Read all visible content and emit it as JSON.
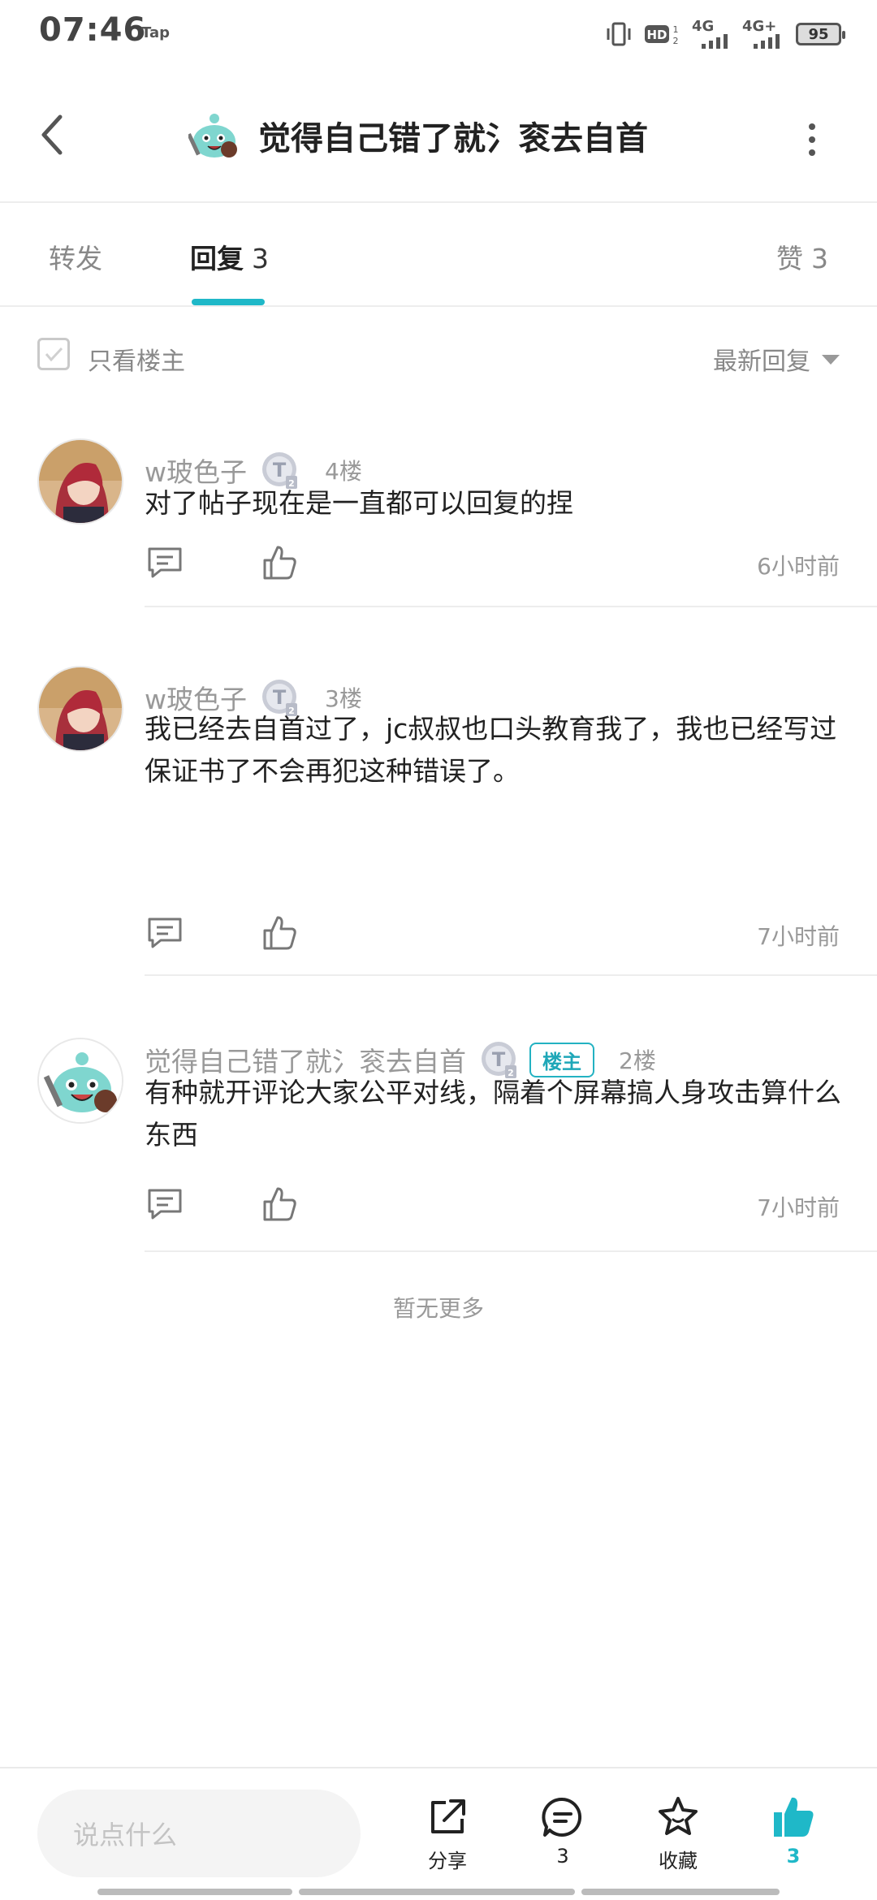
{
  "status_bar": {
    "time": "07:46",
    "app_tag": "Tap",
    "net1": "4G",
    "net2": "4G+",
    "battery": "95"
  },
  "header": {
    "title": "觉得自己错了就氵衮去自首"
  },
  "tabs": [
    {
      "label": "转发",
      "count": ""
    },
    {
      "label": "回复",
      "count": "3"
    },
    {
      "label": "赞",
      "count": "3"
    }
  ],
  "filter": {
    "only_op_label": "只看楼主",
    "sort_label": "最新回复"
  },
  "comments": [
    {
      "name": "w玻色子",
      "floor": "4楼",
      "text": "对了帖子现在是一直都可以回复的捏",
      "time": "6小时前"
    },
    {
      "name": "w玻色子",
      "floor": "3楼",
      "text": "我已经去自首过了，jc叔叔也口头教育我了，我也已经写过保证书了不会再犯这种错误了。",
      "time": "7小时前"
    },
    {
      "name": "觉得自己错了就氵衮去自首",
      "host_tag": "楼主",
      "floor": "2楼",
      "text": "有种就开评论大家公平对线，隔着个屏幕搞人身攻击算什么东西",
      "time": "7小时前"
    }
  ],
  "no_more": "暂无更多",
  "bottom_bar": {
    "input_placeholder": "说点什么",
    "share_label": "分享",
    "comment_count": "3",
    "favorite_label": "收藏",
    "like_count": "3"
  },
  "colors": {
    "accent": "#1fb8c8"
  }
}
